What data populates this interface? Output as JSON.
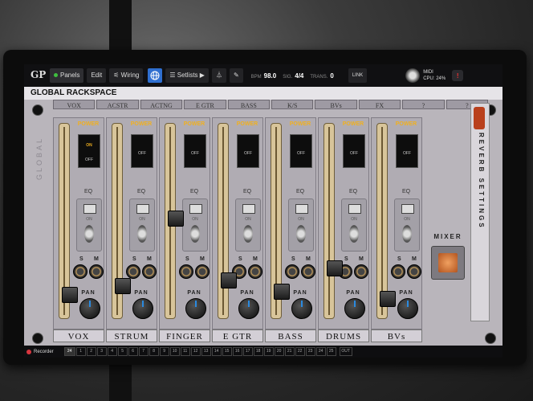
{
  "toolbar": {
    "logo": "GP",
    "panels": "Panels",
    "edit": "Edit",
    "wiring": "Wiring",
    "setlists": "Setlists",
    "bpm_label": "BPM",
    "bpm": "98.0",
    "sig_label": "SIG.",
    "sig": "4/4",
    "trans_label": "TRANS.",
    "trans": "0",
    "link": "LINK",
    "midi": "MIDI",
    "cpu": "CPU: 24%"
  },
  "rackspace": {
    "title": "GLOBAL RACKSPACE"
  },
  "top_tabs": [
    "VOX",
    "ACSTR",
    "ACTNG",
    "E GTR",
    "BASS",
    "K/S",
    "BVs",
    "FX",
    "?",
    "?"
  ],
  "side_label": "GLOBAL",
  "channels": [
    {
      "name": "VOX",
      "power_on": true,
      "fader": 0.1
    },
    {
      "name": "STRUM",
      "power_on": false,
      "fader": 0.15
    },
    {
      "name": "FINGER",
      "power_on": false,
      "fader": 0.52
    },
    {
      "name": "E GTR",
      "power_on": false,
      "fader": 0.18
    },
    {
      "name": "BASS",
      "power_on": false,
      "fader": 0.12
    },
    {
      "name": "DRUMS",
      "power_on": false,
      "fader": 0.25
    },
    {
      "name": "BVs",
      "power_on": false,
      "fader": 0.08
    }
  ],
  "labels": {
    "power": "POWER",
    "on": "ON",
    "off": "OFF",
    "eq": "EQ",
    "s": "S",
    "m": "M",
    "pan": "PAN"
  },
  "reverb": {
    "label": "REVERB SETTINGS"
  },
  "mixer": {
    "label": "MIXER"
  },
  "bottom": {
    "recorder": "Recorder",
    "start": "24",
    "pages": [
      "1",
      "2",
      "3",
      "4",
      "5",
      "6",
      "7",
      "8",
      "9",
      "10",
      "11",
      "12",
      "13",
      "14",
      "15",
      "16",
      "17",
      "18",
      "19",
      "20",
      "21",
      "22",
      "23",
      "24",
      "25"
    ],
    "out": "OUT"
  }
}
